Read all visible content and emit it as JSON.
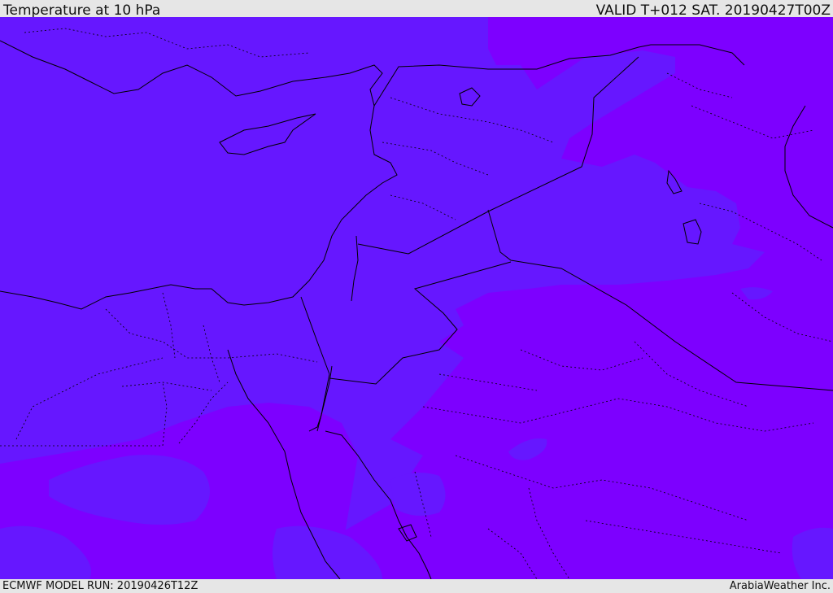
{
  "header": {
    "title": "Temperature at 10 hPa",
    "valid_time": "VALID T+012 SAT. 20190427T00Z"
  },
  "footer": {
    "model_run": "ECMWF MODEL RUN: 20190426T12Z",
    "credit": "ArabiaWeather Inc."
  },
  "map": {
    "colors": {
      "shade_light": "#6617ff",
      "shade_dark": "#7d00ff",
      "border": "#000000"
    },
    "layers": [
      "temperature-fill",
      "coastlines",
      "country-borders",
      "province-borders"
    ]
  }
}
